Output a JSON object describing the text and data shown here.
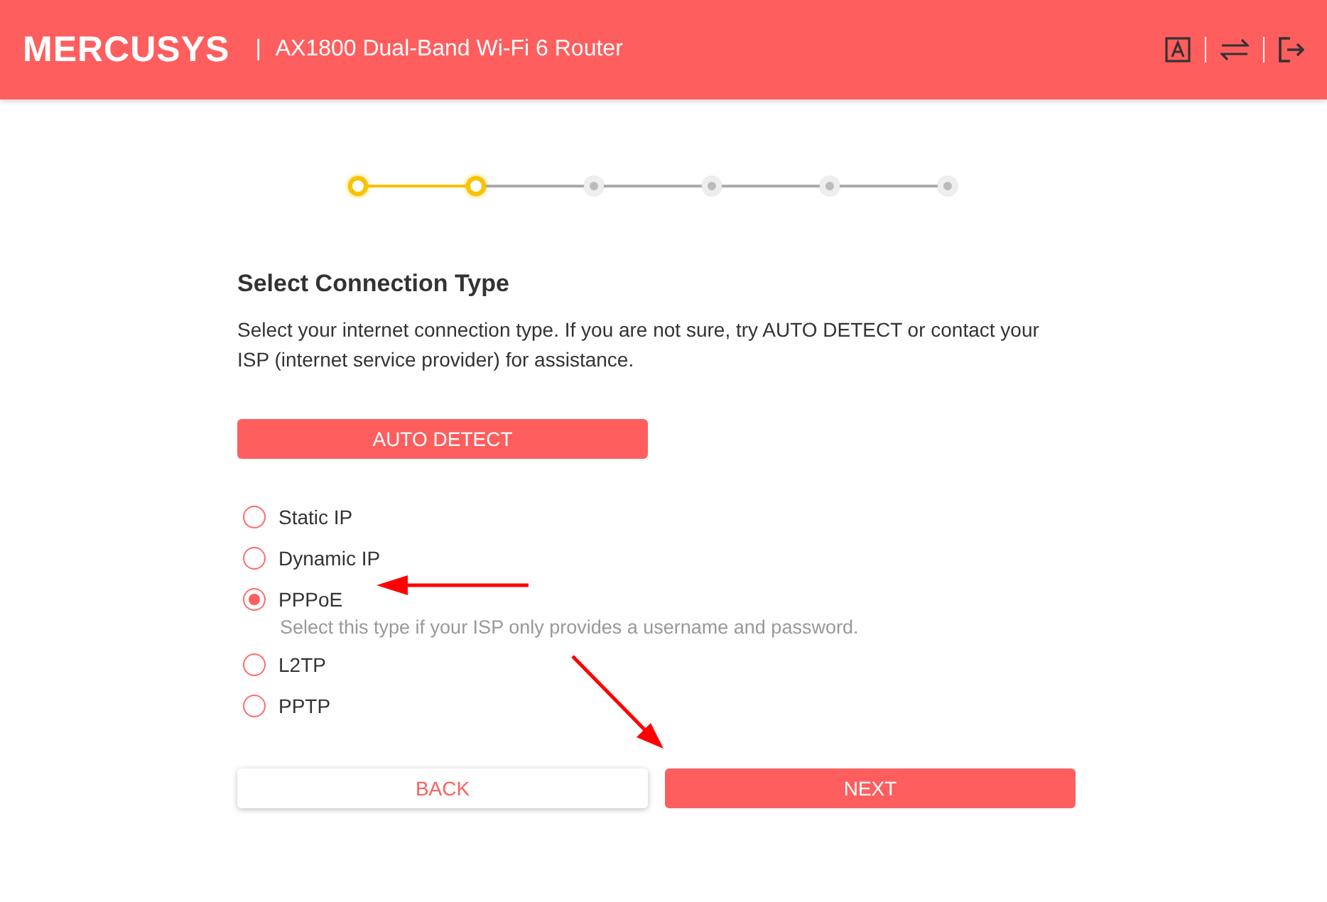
{
  "header": {
    "brand": "MERCUSYS",
    "separator": "|",
    "model": "AX1800 Dual-Band Wi-Fi 6 Router"
  },
  "stepper": [
    {
      "active": true
    },
    {
      "active": true
    },
    {
      "active": false
    },
    {
      "active": false
    },
    {
      "active": false
    },
    {
      "active": false
    }
  ],
  "title": "Select Connection Type",
  "description": "Select your internet connection type. If you are not sure, try AUTO DETECT or contact your ISP (internet service provider) for assistance.",
  "auto_detect": "AUTO DETECT",
  "options": [
    {
      "label": "Static IP",
      "selected": false
    },
    {
      "label": "Dynamic IP",
      "selected": false
    },
    {
      "label": "PPPoE",
      "selected": true,
      "hint": "Select this type if your ISP only provides a username and password."
    },
    {
      "label": "L2TP",
      "selected": false
    },
    {
      "label": "PPTP",
      "selected": false
    }
  ],
  "buttons": {
    "back": "BACK",
    "next": "NEXT"
  }
}
